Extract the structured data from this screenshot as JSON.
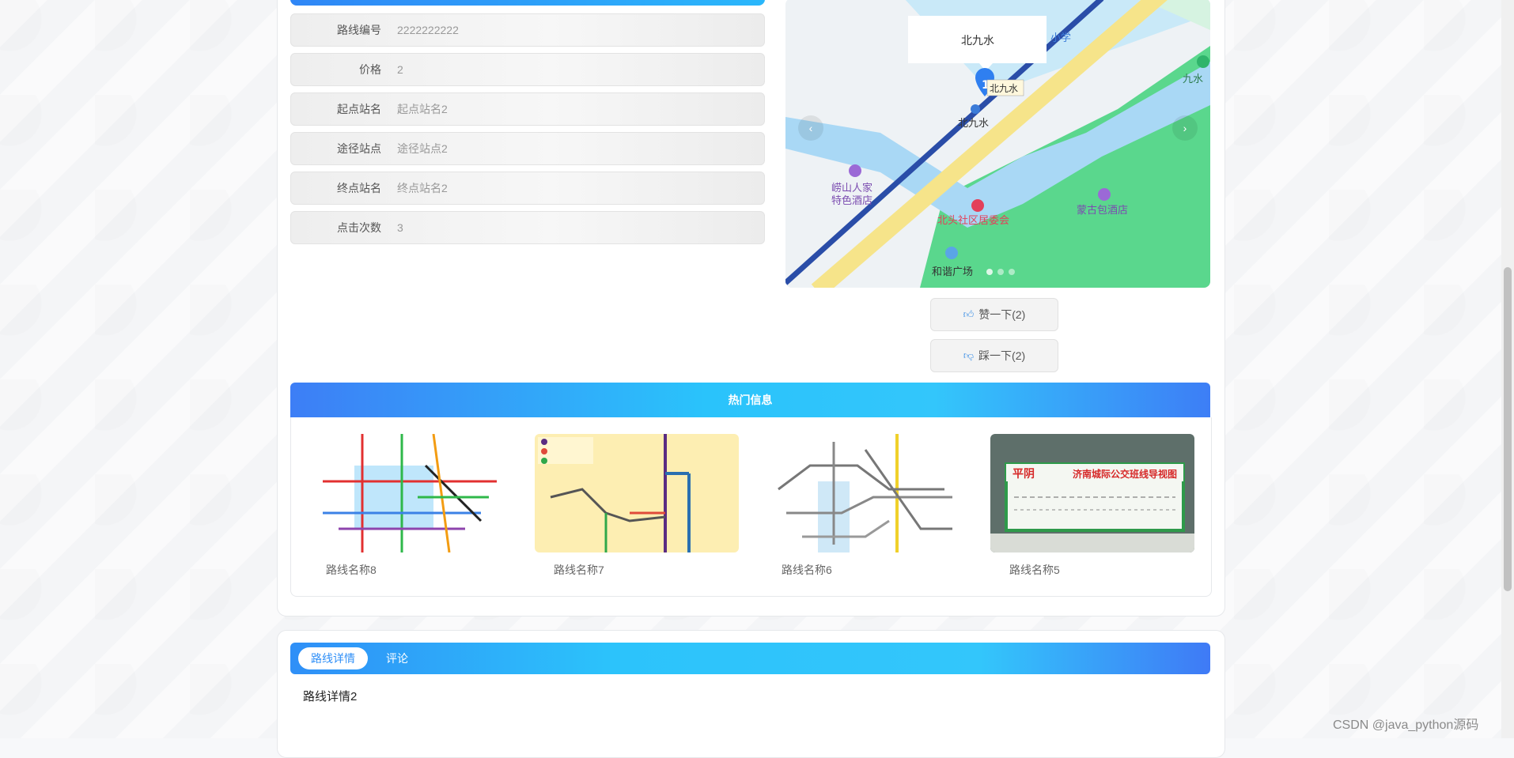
{
  "route": {
    "fields": [
      {
        "label": "路线编号",
        "value": "2222222222"
      },
      {
        "label": "价格",
        "value": "2"
      },
      {
        "label": "起点站名",
        "value": "起点站名2"
      },
      {
        "label": "途径站点",
        "value": "途径站点2"
      },
      {
        "label": "终点站名",
        "value": "终点站名2"
      },
      {
        "label": "点击次数",
        "value": "3"
      }
    ]
  },
  "map": {
    "popup_title": "北九水",
    "marker_tag": "北九水",
    "marker_label": "北九水",
    "poi_1": "崂山人家",
    "poi_1b": "特色酒店",
    "poi_2": "北头社区居委会",
    "poi_3": "蒙古包酒店",
    "poi_4": "和谐广场",
    "poi_5": "九水",
    "poi_6": "小学",
    "marker_number": "1"
  },
  "votes": {
    "like_label": "赞一下(2)",
    "dislike_label": "踩一下(2)"
  },
  "hot": {
    "title": "热门信息",
    "items": [
      {
        "name": "路线名称8"
      },
      {
        "name": "路线名称7"
      },
      {
        "name": "路线名称6"
      },
      {
        "name": "路线名称5",
        "banner_a": "平阴",
        "banner_b": "济南城际公交班线导视图"
      }
    ]
  },
  "tabs": {
    "active": "路线详情",
    "other": "评论"
  },
  "detail_text": "路线详情2",
  "watermark": "CSDN @java_python源码",
  "colors": {
    "accent": "#2f8ff7",
    "gradient_end": "#33c6fb"
  }
}
